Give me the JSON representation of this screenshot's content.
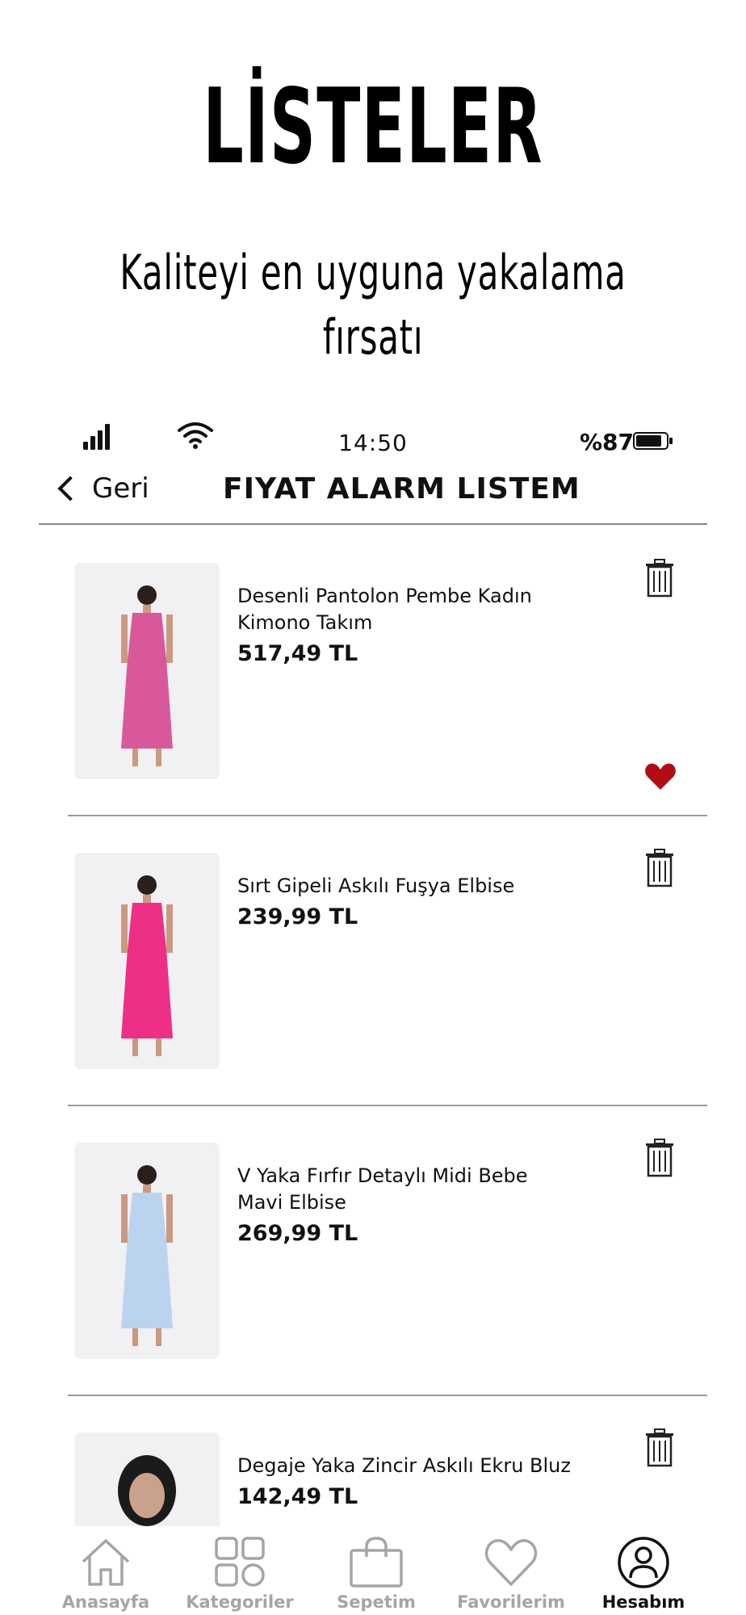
{
  "promo": {
    "title": "LİSTELER",
    "subtitle": "Kaliteyi en uyguna yakalama fırsatı"
  },
  "status_bar": {
    "time": "14:50",
    "battery": "%87",
    "battery_level": 0.87
  },
  "nav": {
    "back_label": "Geri",
    "title": "FIYAT ALARM LISTEM"
  },
  "products": [
    {
      "name": "Desenli Pantolon Pembe Kadın Kimono Takım",
      "price": "517,49 TL",
      "favorite": true,
      "dress_color": "#d9589a"
    },
    {
      "name": "Sırt Gipeli Askılı Fuşya Elbise",
      "price": "239,99 TL",
      "favorite": false,
      "dress_color": "#ee2f86"
    },
    {
      "name": "V Yaka Fırfır Detaylı Midi Bebe Mavi Elbise",
      "price": "269,99 TL",
      "favorite": false,
      "dress_color": "#bcd3ef"
    },
    {
      "name": "Degaje Yaka Zincir Askılı Ekru Bluz",
      "price": "142,49 TL",
      "favorite": false,
      "dress_color": "#e7d6c3"
    }
  ],
  "tabs": [
    {
      "label": "Anasayfa",
      "icon": "home-icon",
      "active": false
    },
    {
      "label": "Kategoriler",
      "icon": "categories-icon",
      "active": false
    },
    {
      "label": "Sepetim",
      "icon": "shopping-bag-icon",
      "active": false
    },
    {
      "label": "Favorilerim",
      "icon": "heart-icon",
      "active": false
    },
    {
      "label": "Hesabım",
      "icon": "user-icon",
      "active": true
    }
  ],
  "colors": {
    "favorite_heart": "#b00d14",
    "tab_inactive": "#a5a5a5",
    "tab_active": "#111111"
  }
}
